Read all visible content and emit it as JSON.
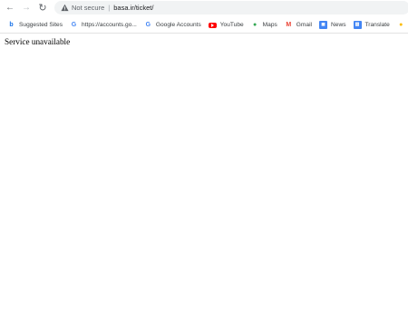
{
  "browser": {
    "security_label": "Not secure",
    "url": "basa.ir/ticket/"
  },
  "bookmarks": [
    {
      "label": "Suggested Sites",
      "icon": "suggested-sites-icon"
    },
    {
      "label": "https://accounts.go...",
      "icon": "google-g-icon"
    },
    {
      "label": "Google Accounts",
      "icon": "google-g-icon"
    },
    {
      "label": "YouTube",
      "icon": "youtube-icon"
    },
    {
      "label": "Maps",
      "icon": "maps-pin-icon"
    },
    {
      "label": "Gmail",
      "icon": "gmail-icon"
    },
    {
      "label": "News",
      "icon": "news-icon"
    },
    {
      "label": "Translate",
      "icon": "translate-icon"
    }
  ],
  "page": {
    "message": "Service unavailable"
  }
}
